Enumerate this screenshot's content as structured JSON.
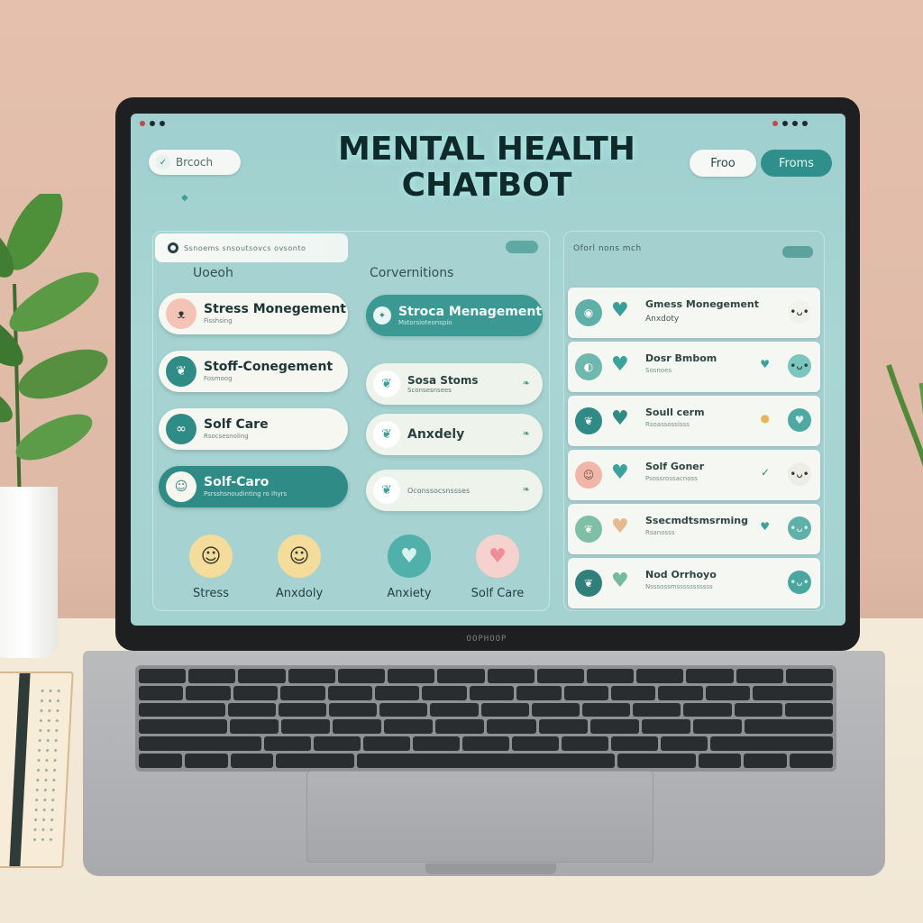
{
  "window": {
    "dot_colors": [
      "#c24a4a",
      "#1e2b2e",
      "#1e2b2e"
    ]
  },
  "header": {
    "search_label": "Brcoch",
    "search_icon": "check-chevron-icon",
    "title_line1": "MENTAL HEALTH",
    "title_line2": "CHATBOT",
    "btn_light": "Froo",
    "btn_dark": "Froms"
  },
  "left_panel": {
    "search_placeholder": "Ssnoems snsoutsovcs ovsonto",
    "col_heads": [
      "Uoeoh",
      "Corvernitions"
    ],
    "col1": [
      {
        "title": "Stress Monegement",
        "sub": "Fisshsing",
        "icon": "bow-icon",
        "color": "#f3c4b5"
      },
      {
        "title": "Stoff-Conegement",
        "sub": "Fosmoog",
        "icon": "leaf-icon",
        "color": "#2f8b86"
      },
      {
        "title": "Solf Care",
        "sub": "Rsocsesnoling",
        "icon": "infinity-icon",
        "color": "#2f8b86"
      },
      {
        "title": "Solf-Caro",
        "sub": "Psrsshsnoudinting ro Ihyrs",
        "icon": "face-icon",
        "color": "#f6f6ef"
      }
    ],
    "col2": [
      {
        "title": "Stroca Menagement",
        "sub": "Mstorsioteonspio",
        "icon": "chat-icon"
      },
      {
        "title": "Sosa Stoms",
        "sub": "Sconsesnsees",
        "icon": "leaf-icon"
      },
      {
        "title": "Anxdely",
        "sub": "",
        "icon": "leaf-icon"
      },
      {
        "title": "",
        "sub": "Oconssocsnssses",
        "icon": "leaf-icon"
      }
    ],
    "moods": [
      {
        "label": "Stress",
        "icon": "smile-icon",
        "color": "#f4dd9a"
      },
      {
        "label": "Anxdoly",
        "icon": "smile-icon",
        "color": "#f4dd9a"
      },
      {
        "label": "Anxiety",
        "icon": "heart-icon",
        "color": "#4fb1aa"
      },
      {
        "label": "Solf Care",
        "icon": "heart-icon",
        "color": "#f6d2cf"
      }
    ]
  },
  "right_panel": {
    "header": "Oforl nons mch",
    "rows": [
      {
        "title": "Gmess Monegement",
        "sub": "Anxdoty",
        "icon_color": "#5fb0a8",
        "heart": "#3a9f98",
        "face_color": "#f2f2ec",
        "mini": ""
      },
      {
        "title": "Dosr Bmbom",
        "sub": "Sosnoes",
        "icon_color": "#6fb8ad",
        "heart": "#3aa39b",
        "face_color": "#7cc6bd",
        "mini": "♥"
      },
      {
        "title": "Soull cerm",
        "sub": "Rsoassossisss",
        "icon_color": "#2f8b86",
        "heart": "#2f8b86",
        "face_color": "#4ea9a2",
        "mini": "✓"
      },
      {
        "title": "Solf Goner",
        "sub": "Psossrossacnoss",
        "icon_color": "#f0b6a9",
        "heart": "#3aa39b",
        "face_color": "#ededE6",
        "mini": "❤"
      },
      {
        "title": "Ssecmdtsmsrming",
        "sub": "Rsanosss",
        "icon_color": "#7fbfa5",
        "heart": "#e6b98f",
        "face_color": "#5fb0a8",
        "mini": "♥"
      },
      {
        "title": "Nod Orrhoyo",
        "sub": "Nsssossmsssssssssss",
        "icon_color": "#2f7f7b",
        "heart": "#76b9a0",
        "face_color": "#4aa7a0",
        "mini": ""
      }
    ]
  },
  "laptop": {
    "brand": "OOPHOOP"
  }
}
